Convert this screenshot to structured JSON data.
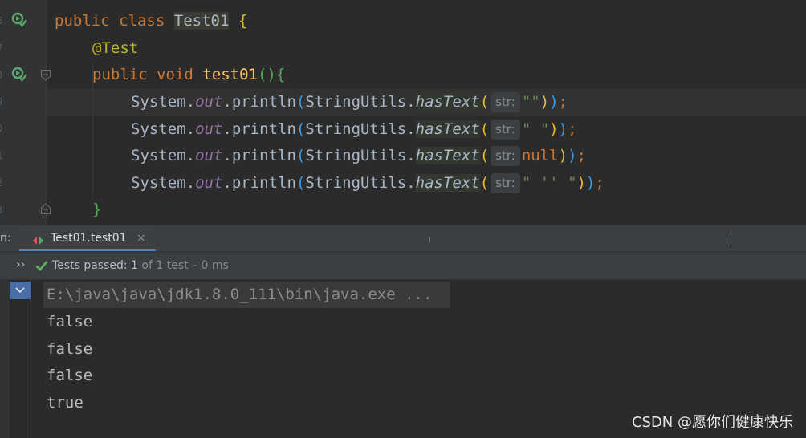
{
  "editor": {
    "line_numbers": [
      "6",
      "7",
      "8",
      "9",
      "0",
      "1",
      "2",
      "3"
    ],
    "line1": {
      "kw_public": "public",
      "kw_class": "class",
      "class_name": "Test01",
      "brace": "{"
    },
    "line2": {
      "annotation": "@Test"
    },
    "line3": {
      "kw_public": "public",
      "kw_void": "void",
      "method": "test01",
      "paren_open": "(",
      "paren_close": ")",
      "brace": "{"
    },
    "calls": [
      {
        "sys": "System.",
        "field": "out",
        "println": ".println",
        "p1": "(",
        "utils": "StringUtils.",
        "method": "hasText",
        "p2": "(",
        "hint": "str:",
        "arg": "\"\"",
        "close2": ")",
        "close1": ")",
        "semi": ";"
      },
      {
        "sys": "System.",
        "field": "out",
        "println": ".println",
        "p1": "(",
        "utils": "StringUtils.",
        "method": "hasText",
        "p2": "(",
        "hint": "str:",
        "arg": "\" \"",
        "close2": ")",
        "close1": ")",
        "semi": ";"
      },
      {
        "sys": "System.",
        "field": "out",
        "println": ".println",
        "p1": "(",
        "utils": "StringUtils.",
        "method": "hasText",
        "p2": "(",
        "hint": "str:",
        "arg": "null",
        "close2": ")",
        "close1": ")",
        "semi": ";"
      },
      {
        "sys": "System.",
        "field": "out",
        "println": ".println",
        "p1": "(",
        "utils": "StringUtils.",
        "method": "hasText",
        "p2": "(",
        "hint": "str:",
        "arg": "\" '' \"",
        "close2": ")",
        "close1": ")",
        "semi": ";"
      }
    ],
    "closing_brace": "}"
  },
  "run_panel": {
    "label": "n:",
    "tab_label": "Test01.test01",
    "tab_close": "×"
  },
  "status": {
    "chevron": "››",
    "passed_label": "Tests passed: ",
    "passed_count": "1",
    "passed_rest": " of 1 test – 0 ms"
  },
  "console": {
    "command": "E:\\java\\java\\jdk1.8.0_111\\bin\\java.exe ...",
    "lines": [
      "false",
      "false",
      "false",
      "true"
    ]
  },
  "watermark": "CSDN @愿你们健康快乐",
  "colors": {
    "accent": "#4a88c7",
    "pass_green": "#5fb85f",
    "keyword": "#cc7832",
    "string": "#6a8759"
  }
}
